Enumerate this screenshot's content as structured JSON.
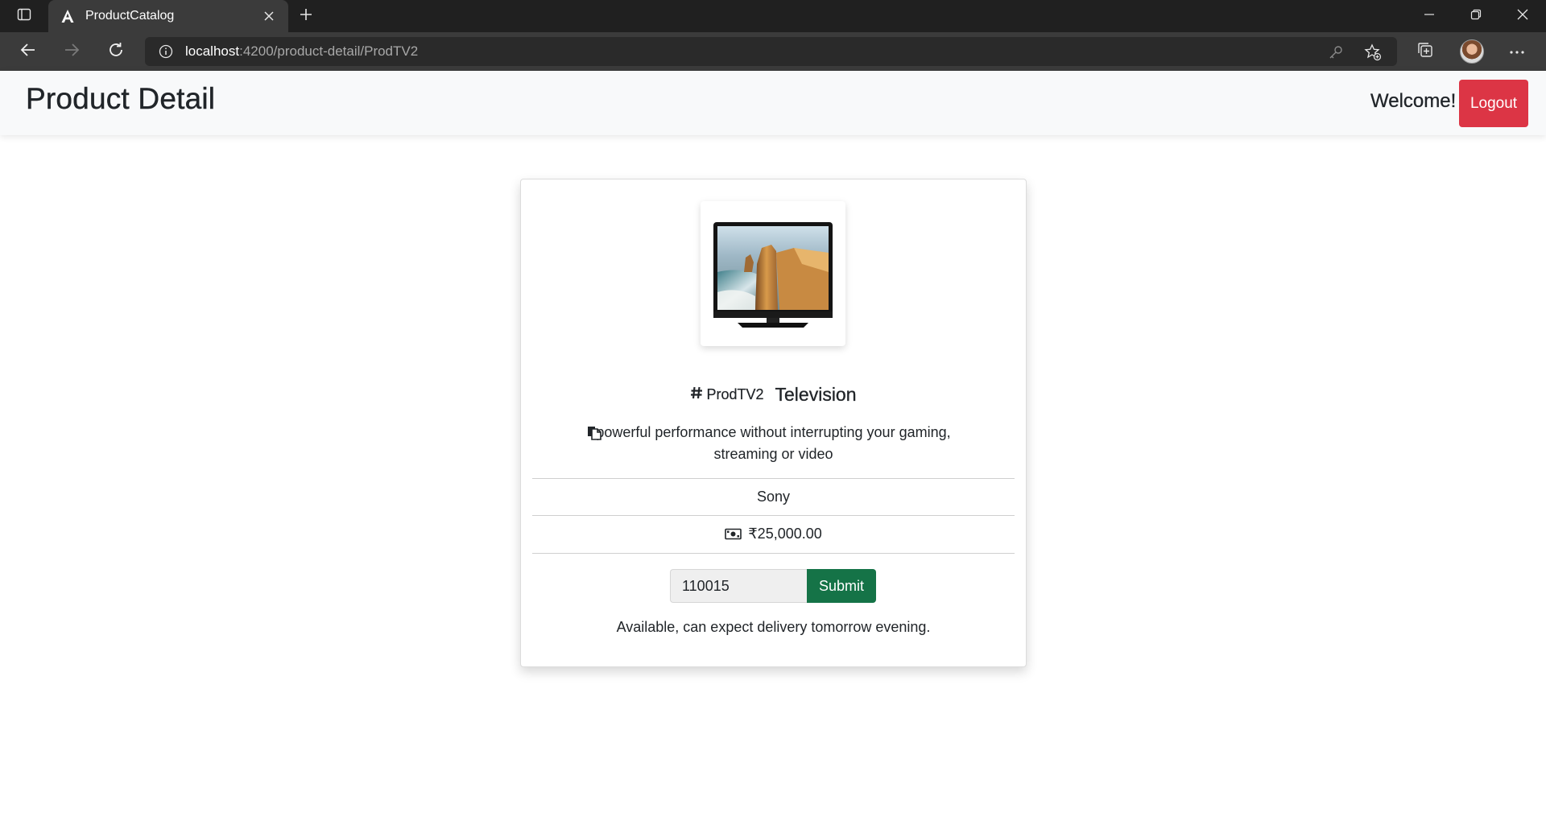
{
  "browser": {
    "tab_title": "ProductCatalog",
    "url_host": "localhost",
    "url_rest": ":4200/product-detail/ProdTV2"
  },
  "header": {
    "title": "Product Detail",
    "welcome": "Welcome!",
    "logout_label": "Logout"
  },
  "product": {
    "code": "ProdTV2",
    "name": "Television",
    "description": "powerful performance without interrupting your gaming, streaming or video",
    "brand": "Sony",
    "price": "₹25,000.00",
    "image_alt": "Television"
  },
  "pincode": {
    "value": "110015",
    "submit_label": "Submit",
    "status": "Available, can expect delivery tomorrow evening."
  },
  "colors": {
    "logout": "#dc3545",
    "submit": "#157347",
    "header_bg": "#f8f9fa"
  },
  "icons": [
    "sidebar-toggle-icon",
    "angular-logo-icon",
    "close-icon",
    "plus-icon",
    "minimize-icon",
    "restore-icon",
    "window-close-icon",
    "back-arrow-icon",
    "forward-arrow-icon",
    "reload-icon",
    "info-icon",
    "key-icon",
    "favorite-add-icon",
    "collections-icon",
    "more-icon",
    "hash-icon",
    "file-copy-icon",
    "cash-icon"
  ]
}
